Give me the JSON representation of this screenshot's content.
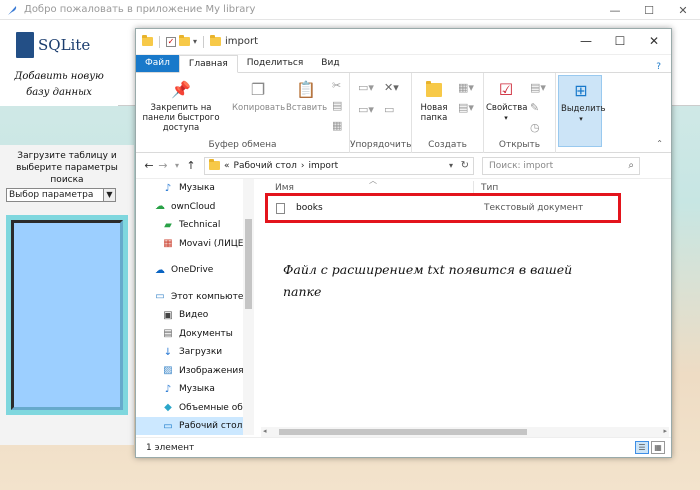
{
  "app": {
    "title": "Добро пожаловать в приложение My library",
    "logo_text": "SQLite",
    "logo_sub_line1": "Добавить новую",
    "logo_sub_line2": "базу данных",
    "left_label": "Загрузите таблицу и выберите параметры поиска",
    "param_select_value": "Выбор параметра"
  },
  "explorer": {
    "title": "import",
    "tabs": [
      "Файл",
      "Главная",
      "Поделиться",
      "Вид"
    ],
    "ribbon": {
      "pin_label": "Закрепить на панели быстрого доступа",
      "copy_label": "Копировать",
      "paste_label": "Вставить",
      "clipboard_group": "Буфер обмена",
      "organize_group": "Упорядочить",
      "new_folder_label": "Новая папка",
      "create_group": "Создать",
      "properties_label": "Свойства",
      "open_group": "Открыть",
      "select_label": "Выделить"
    },
    "address": {
      "prefix": "«",
      "crumb1": "Рабочий стол",
      "sep": "›",
      "crumb2": "import"
    },
    "search_placeholder": "Поиск: import",
    "nav_items": [
      {
        "label": "Музыка",
        "icon": "music-icon"
      },
      {
        "label": "ownCloud",
        "icon": "owncloud-icon"
      },
      {
        "label": "Technical",
        "icon": "folder-icon"
      },
      {
        "label": "Movavi (ЛИЦЕН",
        "icon": "movavi-icon"
      },
      {
        "label": "OneDrive",
        "icon": "cloud-icon"
      },
      {
        "label": "Этот компьютер",
        "icon": "computer-icon"
      },
      {
        "label": "Видео",
        "icon": "video-icon"
      },
      {
        "label": "Документы",
        "icon": "documents-icon"
      },
      {
        "label": "Загрузки",
        "icon": "download-icon"
      },
      {
        "label": "Изображения",
        "icon": "images-icon"
      },
      {
        "label": "Музыка",
        "icon": "music-icon"
      },
      {
        "label": "Объемные объ",
        "icon": "3d-objects-icon"
      },
      {
        "label": "Рабочий стол",
        "icon": "desktop-icon"
      }
    ],
    "columns": {
      "name": "Имя",
      "type": "Тип"
    },
    "files": [
      {
        "name": "books",
        "type": "Текстовый документ"
      }
    ],
    "note": "Файл с расширением txt появится в вашей папке",
    "status": "1 элемент",
    "colors": {
      "accent": "#1979ca",
      "highlight": "#e3141c",
      "selection": "#cce8ff"
    }
  }
}
